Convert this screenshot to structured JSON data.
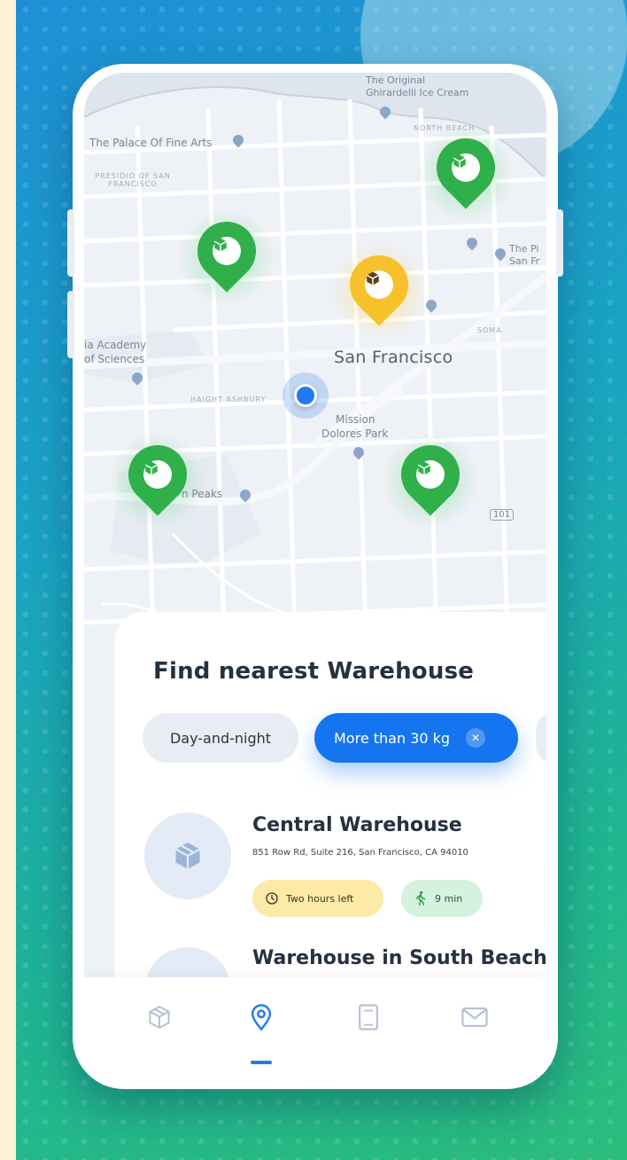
{
  "map": {
    "labels": {
      "city": "San Francisco",
      "palace": "The Palace Of Fine Arts",
      "presidio": "PRESIDIO OF SAN FRANCISCO",
      "ghirardelli_1": "The Original",
      "ghirardelli_2": "Ghirardelli Ice Cream",
      "north_beach": "NORTH BEACH",
      "academy_1": "ia Academy",
      "academy_2": "of Sciences",
      "haight": "HAIGHT ASHBURY",
      "mission_1": "Mission",
      "mission_2": "Dolores Park",
      "twin_peaks": "n Peaks",
      "soma": "SOMA",
      "pier_1": "The Pi",
      "pier_2": "San Fr",
      "highway_101": "101"
    },
    "pins": [
      {
        "id": "pin-green-1",
        "color": "#2fb04a",
        "glow": "rgba(48,200,80,0.35)"
      },
      {
        "id": "pin-green-2",
        "color": "#2fb04a",
        "glow": "rgba(48,200,80,0.35)"
      },
      {
        "id": "pin-yellow",
        "color": "#f6c12a",
        "glow": "rgba(255,210,60,0.45)"
      },
      {
        "id": "pin-green-3",
        "color": "#2fb04a",
        "glow": "rgba(48,200,80,0.35)"
      },
      {
        "id": "pin-green-4",
        "color": "#2fb04a",
        "glow": "rgba(48,200,80,0.35)"
      }
    ],
    "pin_icon": "package-icon",
    "user_location_icon": "user-location-icon"
  },
  "sheet": {
    "title": "Find nearest Warehouse",
    "filters": [
      {
        "label": "Day-and-night",
        "selected": false
      },
      {
        "label": "More than 30 kg",
        "selected": true,
        "close_icon": "close-icon"
      }
    ],
    "warehouses": [
      {
        "name": "Central Warehouse",
        "address": "851 Row Rd, Suite 216, San Francisco, CA 94010",
        "time_badge": "Two hours left",
        "time_icon": "clock-icon",
        "walk_badge": "9 min",
        "walk_icon": "walking-person-icon",
        "icon": "box-icon"
      },
      {
        "name": "Warehouse in South Beach",
        "icon": "box-icon"
      }
    ]
  },
  "tabbar": {
    "tabs": [
      {
        "name": "tab-packages",
        "icon": "box-outline-icon",
        "active": false
      },
      {
        "name": "tab-map",
        "icon": "map-pin-icon",
        "active": true
      },
      {
        "name": "tab-documents",
        "icon": "document-icon",
        "active": false
      },
      {
        "name": "tab-messages",
        "icon": "mail-icon",
        "active": false
      }
    ]
  },
  "colors": {
    "accent": "#1575f0",
    "green_pin": "#2fb04a",
    "yellow_pin": "#f6c12a",
    "time_badge_bg": "#fde9a8",
    "walk_badge_bg": "#d5f2de"
  }
}
